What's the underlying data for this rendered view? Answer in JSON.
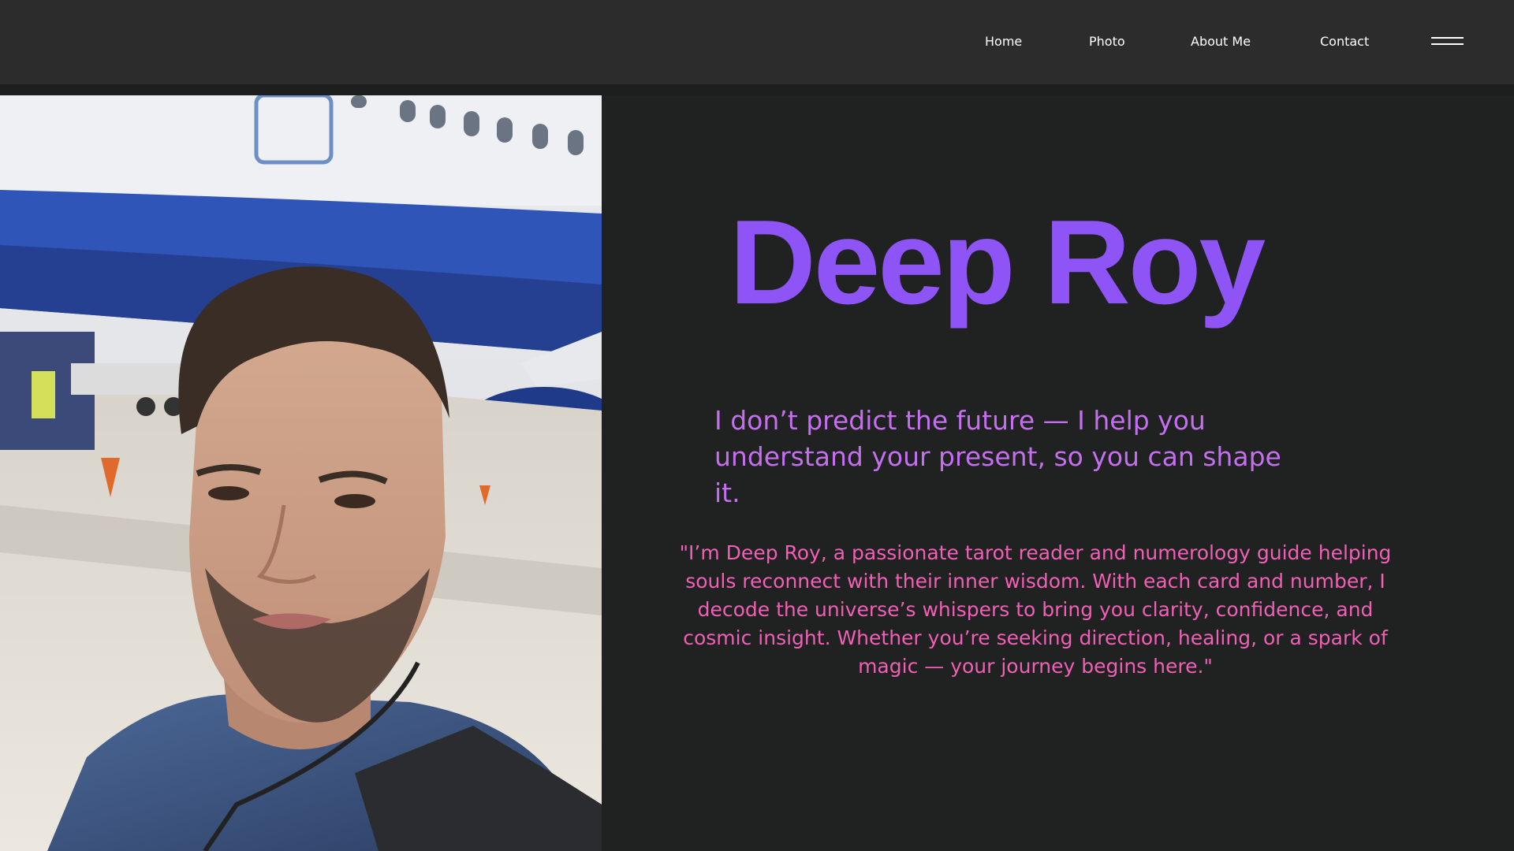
{
  "header": {
    "nav": {
      "home": "Home",
      "photo": "Photo",
      "about": "About Me",
      "contact": "Contact"
    },
    "menu_icon": "hamburger-menu-icon"
  },
  "hero": {
    "title": "Deep Roy",
    "tagline": "I don’t predict the future — I help you understand your present, so you can shape it.",
    "bio": "\"I’m Deep Roy, a passionate tarot reader and numerology guide helping souls reconnect with their inner wisdom. With each card and number, I decode the universe’s whispers to bring you clarity, confidence, and cosmic insight. Whether you’re seeking direction, healing, or a spark of magic — your journey begins here.\""
  },
  "colors": {
    "page_background": "#202121",
    "header_background": "#2c2c2c",
    "title": "#8e54f5",
    "tagline": "#c56ff0",
    "bio": "#f25fb6",
    "nav_text": "#ffffff"
  }
}
